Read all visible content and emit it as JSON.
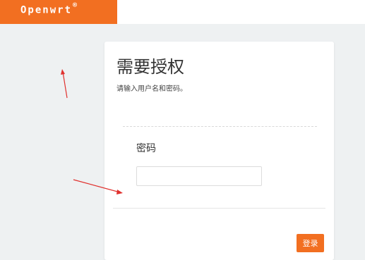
{
  "header": {
    "logo_text": "Openwrt",
    "logo_mark": "®",
    "brand_color": "#f26f21"
  },
  "login": {
    "title": "需要授权",
    "subtitle": "请输入用户名和密码。",
    "password_label": "密码",
    "password_value": "",
    "login_button": "登录"
  },
  "annotations": {
    "color": "#e0312e",
    "items": [
      "arrow",
      "arrow"
    ]
  }
}
